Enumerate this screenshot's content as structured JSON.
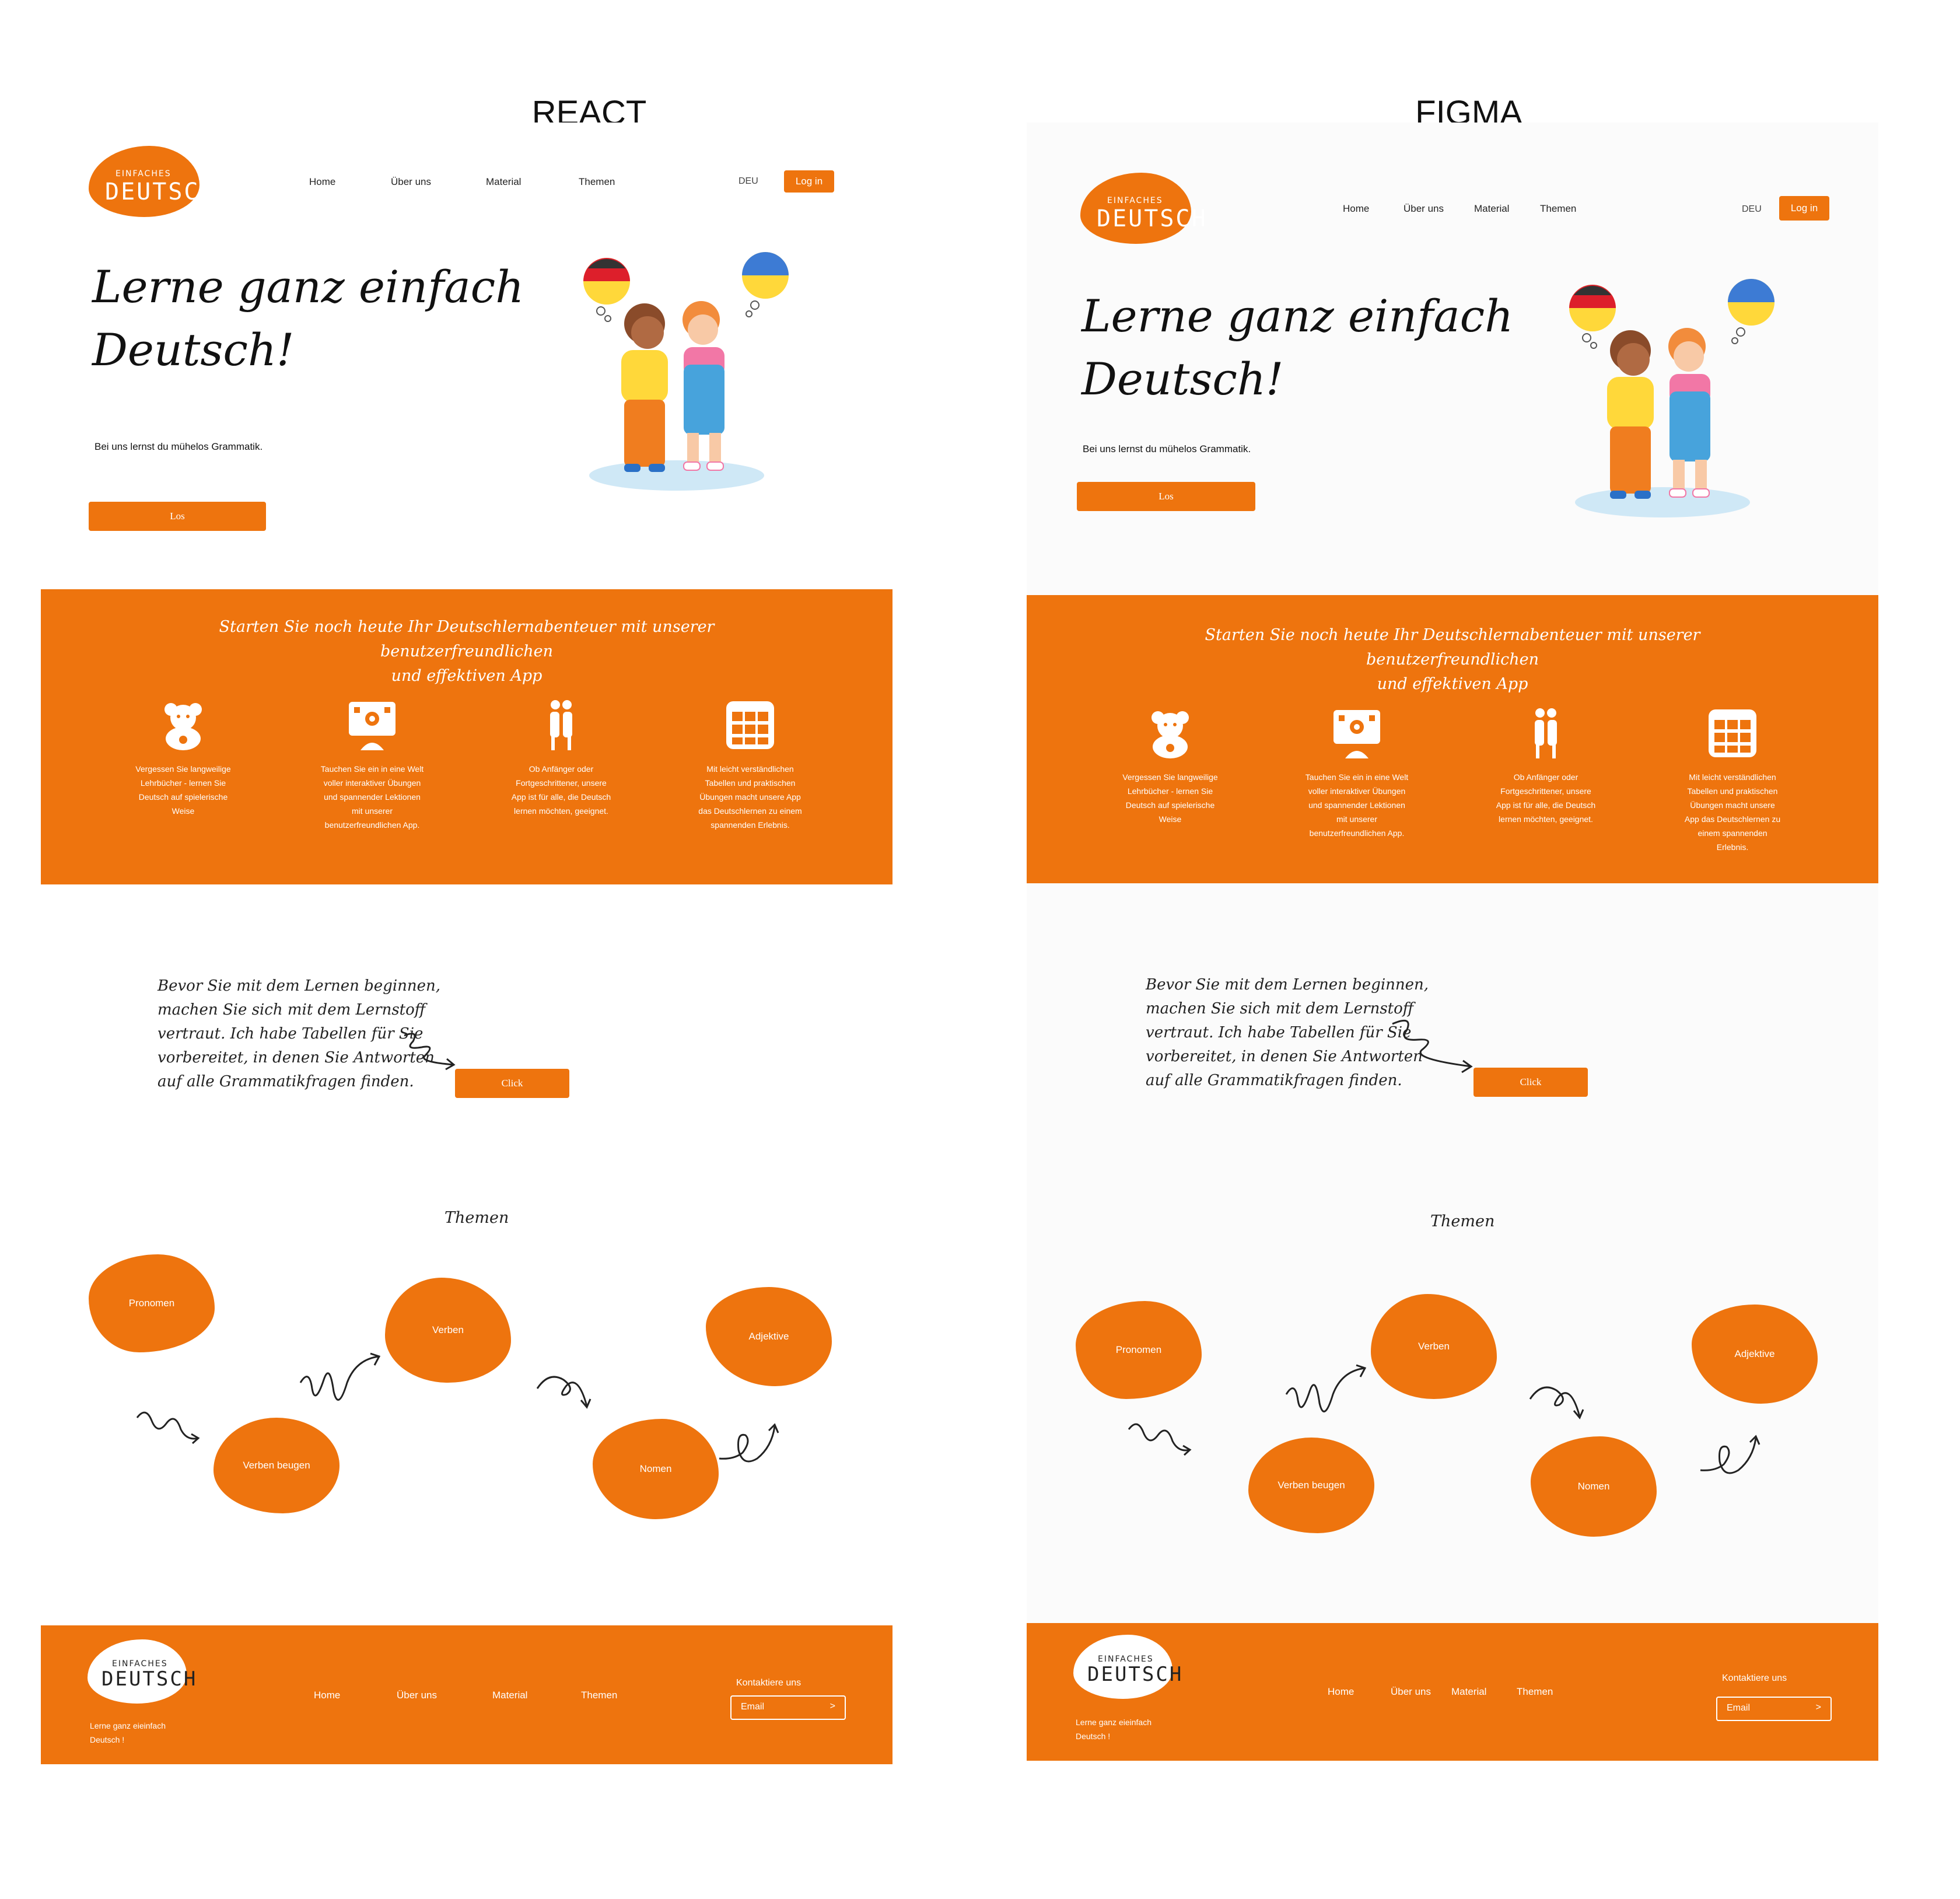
{
  "columns": {
    "left": "REACT",
    "right": "FIGMA"
  },
  "brand": {
    "small": "EINFACHES",
    "big": "DEUTSCH"
  },
  "nav": {
    "home": "Home",
    "about": "Über uns",
    "material": "Material",
    "topics": "Themen"
  },
  "lang": "DEU",
  "login": "Log in",
  "hero": {
    "headline_line1": "Lerne ganz einfach",
    "headline_line2": "Deutsch!",
    "subline": "Bei uns lernst du mühelos Grammatik.",
    "button": "Los"
  },
  "promo": {
    "title_line1": "Starten Sie noch heute Ihr Deutschlernabenteuer mit unserer benutzerfreundlichen",
    "title_line2": "und effektiven App",
    "features": [
      {
        "icon": "teddy-bear-icon",
        "lines": [
          "Vergessen Sie langweilige",
          "Lehrbücher - lernen Sie",
          "Deutsch auf spielerische",
          "Weise"
        ]
      },
      {
        "icon": "app-screen-icon",
        "lines": [
          "Tauchen Sie ein in eine Welt",
          "voller interaktiver Übungen",
          "und spannender Lektionen",
          "mit unserer",
          "benutzerfreundlichen App."
        ]
      },
      {
        "icon": "people-icon",
        "lines": [
          "Ob Anfänger oder",
          "Fortgeschrittener, unsere",
          "App ist für alle, die Deutsch",
          "lernen möchten, geeignet."
        ]
      },
      {
        "icon": "table-grid-icon",
        "lines": [
          "Mit leicht verständlichen",
          "Tabellen und praktischen",
          "Übungen macht unsere App",
          "das Deutschlernen zu einem",
          "spannenden Erlebnis."
        ]
      }
    ],
    "figma_feature4_lines": [
      "Mit leicht verständlichen",
      "Tabellen und praktischen",
      "Übungen macht unsere",
      "App das Deutschlernen zu",
      "einem spannenden",
      "Erlebnis."
    ]
  },
  "intro": {
    "lines": [
      "Bevor Sie mit dem Lernen beginnen,",
      "machen Sie sich mit dem Lernstoff",
      "vertraut. Ich habe Tabellen für Sie",
      "vorbereitet, in denen Sie Antworten",
      "auf alle Grammatikfragen finden."
    ],
    "button": "Click"
  },
  "topics": {
    "title": "Themen",
    "items": [
      "Pronomen",
      "Verben",
      "Adjektive",
      "Verben beugen",
      "Nomen"
    ]
  },
  "footer": {
    "tagline_line1": "Lerne ganz eieinfach",
    "tagline_line2": "Deutsch !",
    "contact": "Kontaktiere uns",
    "email": "Email",
    "arrow": ">"
  },
  "colors": {
    "accent": "#ee740e",
    "flag_de": [
      "#333333",
      "#dd1f2b",
      "#ffcc00"
    ],
    "flag_ua": [
      "#3d7bd4",
      "#ffd83a"
    ]
  }
}
